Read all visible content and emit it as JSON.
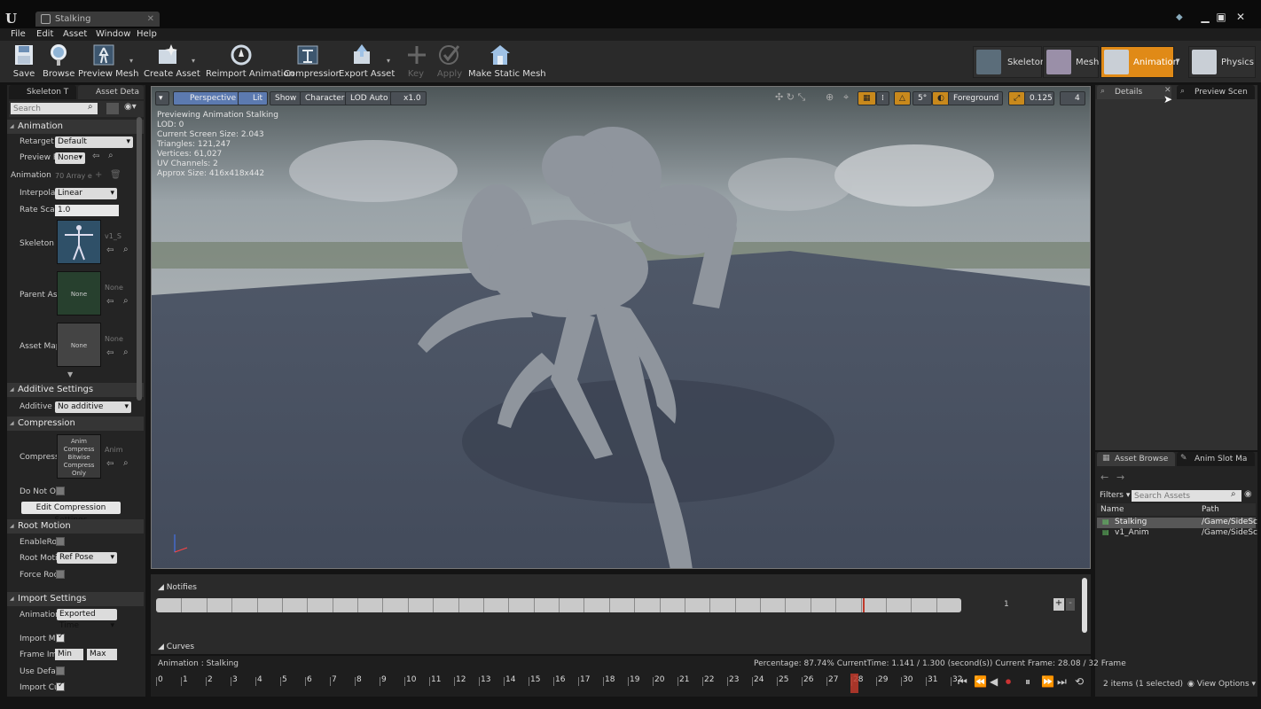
{
  "window": {
    "tab_title": "Stalking",
    "minimize": "▁",
    "maximize": "▣",
    "close": "✕"
  },
  "menu": [
    "File",
    "Edit",
    "Asset",
    "Window",
    "Help"
  ],
  "toolbar": [
    {
      "label": "Save",
      "enabled": true
    },
    {
      "label": "Browse",
      "enabled": true
    },
    {
      "label": "Preview Mesh",
      "enabled": true
    },
    {
      "label": "Create Asset",
      "enabled": true
    },
    {
      "label": "Reimport Animation",
      "enabled": true
    },
    {
      "label": "Compression",
      "enabled": true
    },
    {
      "label": "Export Asset",
      "enabled": true
    },
    {
      "label": "Key",
      "enabled": false
    },
    {
      "label": "Apply",
      "enabled": false
    },
    {
      "label": "Make Static Mesh",
      "enabled": true
    }
  ],
  "modes": [
    {
      "label": "Skeleton",
      "active": false
    },
    {
      "label": "Mesh",
      "active": false
    },
    {
      "label": "Animation",
      "active": true
    },
    {
      "label": "Physics",
      "active": false
    }
  ],
  "left_tabs": [
    "Skeleton T",
    "Asset Deta"
  ],
  "search_placeholder": "Search",
  "sections": {
    "animation": "Animation",
    "additive": "Additive Settings",
    "compression": "Compression",
    "root_motion": "Root Motion",
    "import": "Import Settings"
  },
  "props": {
    "retarget": {
      "label": "Retarget S",
      "value": "Default"
    },
    "preview_pose": {
      "label": "Preview P",
      "value": "None"
    },
    "animation_array": {
      "label": "Animation",
      "value": "70 Array e"
    },
    "interpolation": {
      "label": "Interpolati",
      "value": "Linear"
    },
    "rate_scale": {
      "label": "Rate Scale",
      "value": "1.0"
    },
    "skeleton": {
      "label": "Skeleton",
      "value": "v1_S"
    },
    "parent_asset": {
      "label": "Parent As",
      "value": "None",
      "thumb": "None"
    },
    "asset_map": {
      "label": "Asset Map",
      "value": "None",
      "thumb": "None"
    },
    "additive_anim": {
      "label": "Additive A",
      "value": "No additive"
    },
    "compress": {
      "label": "Compress",
      "value": "Anim",
      "thumb": "Anim Compress Bitwise Compress Only"
    },
    "do_not_override": {
      "label": "Do Not Ov"
    },
    "edit_compression": "Edit Compression Settings",
    "enable_root": {
      "label": "EnableRoo"
    },
    "root_motion_mode": {
      "label": "Root Moti",
      "value": "Ref Pose"
    },
    "force_root": {
      "label": "Force Roo"
    },
    "import_animation": {
      "label": "Animation",
      "value": "Exported Time"
    },
    "import_meshes": {
      "label": "Import Me"
    },
    "frame_import": {
      "label": "Frame Im",
      "min": "Min",
      "max": "Max"
    },
    "use_default": {
      "label": "Use Defau"
    },
    "import_curves": {
      "label": "Import Cu"
    }
  },
  "viewport": {
    "menu_btn": "▾",
    "perspective": "Perspective",
    "lit": "Lit",
    "show": "Show",
    "character": "Character",
    "lod": "LOD Auto",
    "speed": "x1.0",
    "foreground": "Foreground",
    "scale": "0.125",
    "snap_angle": "5°",
    "cam_speed": "4",
    "stats": [
      "Previewing Animation Stalking",
      "LOD: 0",
      "Current Screen Size: 2.043",
      "Triangles: 121,247",
      "Vertices: 61,027",
      "UV Channels: 2",
      "Approx Size: 416x418x442"
    ]
  },
  "right_tabs": [
    "Details",
    "Preview Scen"
  ],
  "asset_tabs": [
    "Asset Browse",
    "Anim Slot Ma"
  ],
  "assets": {
    "filters": "Filters",
    "search_placeholder": "Search Assets",
    "col_name": "Name",
    "col_path": "Path",
    "rows": [
      {
        "name": "Stalking",
        "path": "/Game/SideSc",
        "selected": true
      },
      {
        "name": "v1_Anim",
        "path": "/Game/SideSc",
        "selected": false
      }
    ],
    "footer": "2 items (1 selected)",
    "view_options": "View Options"
  },
  "notifies": {
    "title": "Notifies",
    "curves": "Curves",
    "track_count": "1",
    "add": "+",
    "remove": "-"
  },
  "timeline": {
    "anim_label": "Animation :  Stalking",
    "status": "Percentage:  87.74%  CurrentTime:  1.141 / 1.300 (second(s))  Current Frame:  28.08 / 32 Frame",
    "ticks": [
      "0",
      "1",
      "2",
      "3",
      "4",
      "5",
      "6",
      "7",
      "8",
      "9",
      "10",
      "11",
      "12",
      "13",
      "14",
      "15",
      "16",
      "17",
      "18",
      "19",
      "20",
      "21",
      "22",
      "23",
      "24",
      "25",
      "26",
      "27",
      "28",
      "29",
      "30",
      "31",
      "32"
    ],
    "current_frame": 28.08,
    "total_frames": 32
  },
  "colors": {
    "accent": "#e08a17",
    "viewport_btn": "#5c7ab0",
    "scrub": "#c0392b"
  }
}
